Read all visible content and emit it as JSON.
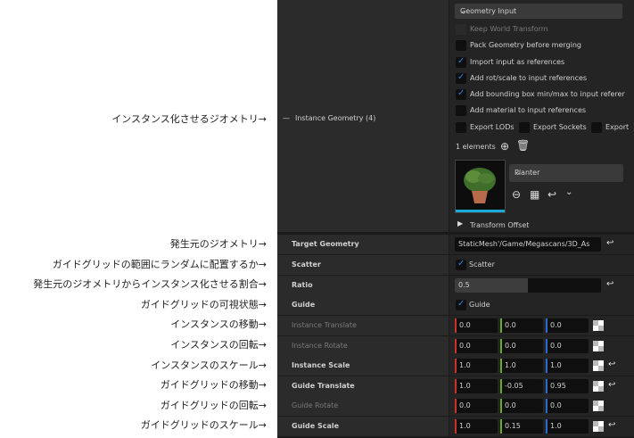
{
  "annotations": [
    "インスタンス化させるジオメトリ→",
    "発生元のジオメトリ→",
    "ガイドグリッドの範囲にランダムに配置するか→",
    "発生元のジオメトリからインスタンス化させる割合→",
    "ガイドグリッドの可視状態→",
    "インスタンスの移動→",
    "インスタンスの回転→",
    "インスタンスのスケール→",
    "ガイドグリッドの移動→",
    "ガイドグリッドの回転→",
    "ガイドグリッドのスケール→"
  ],
  "instance_geometry": {
    "label": "Instance Geometry (4)",
    "collapse_glyph": "—",
    "input_type": "Geometry Input",
    "options": {
      "keep_world_transform": {
        "label": "Keep World Transform",
        "checked": false,
        "disabled": true
      },
      "pack_geometry": {
        "label": "Pack Geometry before merging",
        "checked": false
      },
      "import_as_refs": {
        "label": "Import input as references",
        "checked": true
      },
      "add_rot_scale": {
        "label": "Add rot/scale to input references",
        "checked": true
      },
      "add_bbox": {
        "label": "Add bounding box min/max to input referer",
        "checked": true
      },
      "add_material": {
        "label": "Add material to input references",
        "checked": false
      },
      "export_lods": {
        "label": "Export LODs",
        "checked": false
      },
      "export_sockets": {
        "label": "Export Sockets",
        "checked": false
      },
      "export_more": {
        "label": "Export",
        "checked": false
      }
    },
    "elements_count": "1 elements",
    "asset_name": "Planter",
    "transform_offset": "Transform Offset"
  },
  "rows": {
    "target_geometry": {
      "label": "Target Geometry",
      "value": "StaticMesh'/Game/Megascans/3D_As"
    },
    "scatter": {
      "label": "Scatter",
      "checkbox_label": "Scatter",
      "checked": true
    },
    "ratio": {
      "label": "Ratio",
      "value": "0.5",
      "fill": 0.5
    },
    "guide": {
      "label": "Guide",
      "checkbox_label": "Guide",
      "checked": true
    },
    "instance_translate": {
      "label": "Instance Translate",
      "x": "0.0",
      "y": "0.0",
      "z": "0.0"
    },
    "instance_rotate": {
      "label": "Instance Rotate",
      "x": "0.0",
      "y": "0.0",
      "z": "0.0"
    },
    "instance_scale": {
      "label": "Instance Scale",
      "x": "1.0",
      "y": "1.0",
      "z": "1.0"
    },
    "guide_translate": {
      "label": "Guide Translate",
      "x": "1.0",
      "y": "-0.05",
      "z": "0.95"
    },
    "guide_rotate": {
      "label": "Guide Rotate",
      "x": "0.0",
      "y": "0.0",
      "z": "0.0"
    },
    "guide_scale": {
      "label": "Guide Scale",
      "x": "1.0",
      "y": "0.15",
      "z": "1.0"
    }
  },
  "colors": {
    "x_axis": "#c8352b",
    "y_axis": "#6aa82e",
    "z_axis": "#2a6ad0",
    "check": "#2e7fe0"
  },
  "icons": [
    "chevron-down-icon",
    "add-icon",
    "trash-icon",
    "browse-icon",
    "folder-icon",
    "reset-arrow-icon",
    "lock-icon",
    "expand-arrow-icon"
  ]
}
